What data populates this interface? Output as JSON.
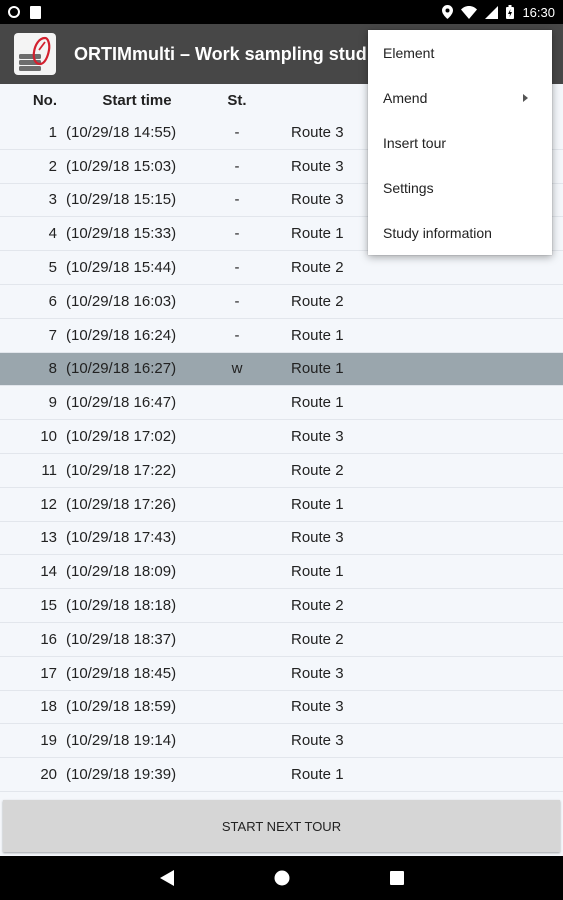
{
  "status_bar": {
    "time": "16:30",
    "left_icons": [
      "notification-circle-icon",
      "sd-card-icon"
    ],
    "right_icons": [
      "location-icon",
      "wifi-icon",
      "signal-icon",
      "battery-icon"
    ]
  },
  "app_bar": {
    "title": "ORTIMmulti – Work sampling stud"
  },
  "table": {
    "headers": {
      "no": "No.",
      "start_time": "Start time",
      "st": "St."
    },
    "rows": [
      {
        "no": "1",
        "time": "(10/29/18 14:55)",
        "st": "-",
        "route": "Route 3"
      },
      {
        "no": "2",
        "time": "(10/29/18 15:03)",
        "st": "-",
        "route": "Route 3"
      },
      {
        "no": "3",
        "time": "(10/29/18 15:15)",
        "st": "-",
        "route": "Route 3"
      },
      {
        "no": "4",
        "time": "(10/29/18 15:33)",
        "st": "-",
        "route": "Route 1"
      },
      {
        "no": "5",
        "time": "(10/29/18 15:44)",
        "st": "-",
        "route": "Route 2"
      },
      {
        "no": "6",
        "time": "(10/29/18 16:03)",
        "st": "-",
        "route": "Route 2"
      },
      {
        "no": "7",
        "time": "(10/29/18 16:24)",
        "st": "-",
        "route": "Route 1"
      },
      {
        "no": "8",
        "time": "(10/29/18 16:27)",
        "st": "w",
        "route": "Route 1",
        "selected": true
      },
      {
        "no": "9",
        "time": "(10/29/18 16:47)",
        "st": "",
        "route": "Route 1"
      },
      {
        "no": "10",
        "time": "(10/29/18 17:02)",
        "st": "",
        "route": "Route 3"
      },
      {
        "no": "11",
        "time": "(10/29/18 17:22)",
        "st": "",
        "route": "Route 2"
      },
      {
        "no": "12",
        "time": "(10/29/18 17:26)",
        "st": "",
        "route": "Route 1"
      },
      {
        "no": "13",
        "time": "(10/29/18 17:43)",
        "st": "",
        "route": "Route 3"
      },
      {
        "no": "14",
        "time": "(10/29/18 18:09)",
        "st": "",
        "route": "Route 1"
      },
      {
        "no": "15",
        "time": "(10/29/18 18:18)",
        "st": "",
        "route": "Route 2"
      },
      {
        "no": "16",
        "time": "(10/29/18 18:37)",
        "st": "",
        "route": "Route 2"
      },
      {
        "no": "17",
        "time": "(10/29/18 18:45)",
        "st": "",
        "route": "Route 3"
      },
      {
        "no": "18",
        "time": "(10/29/18 18:59)",
        "st": "",
        "route": "Route 3"
      },
      {
        "no": "19",
        "time": "(10/29/18 19:14)",
        "st": "",
        "route": "Route 3"
      },
      {
        "no": "20",
        "time": "(10/29/18 19:39)",
        "st": "",
        "route": "Route 1"
      }
    ]
  },
  "bottom": {
    "next_tour_label": "START NEXT TOUR"
  },
  "menu": {
    "items": [
      {
        "label": "Element",
        "submenu": false
      },
      {
        "label": "Amend",
        "submenu": true
      },
      {
        "label": "Insert tour",
        "submenu": false
      },
      {
        "label": "Settings",
        "submenu": false
      },
      {
        "label": "Study information",
        "submenu": false
      }
    ]
  },
  "colors": {
    "app_bar": "#474747",
    "selected_row": "#9aa6ad",
    "list_background": "#f4f7fb",
    "logo_accent": "#d3202e"
  }
}
